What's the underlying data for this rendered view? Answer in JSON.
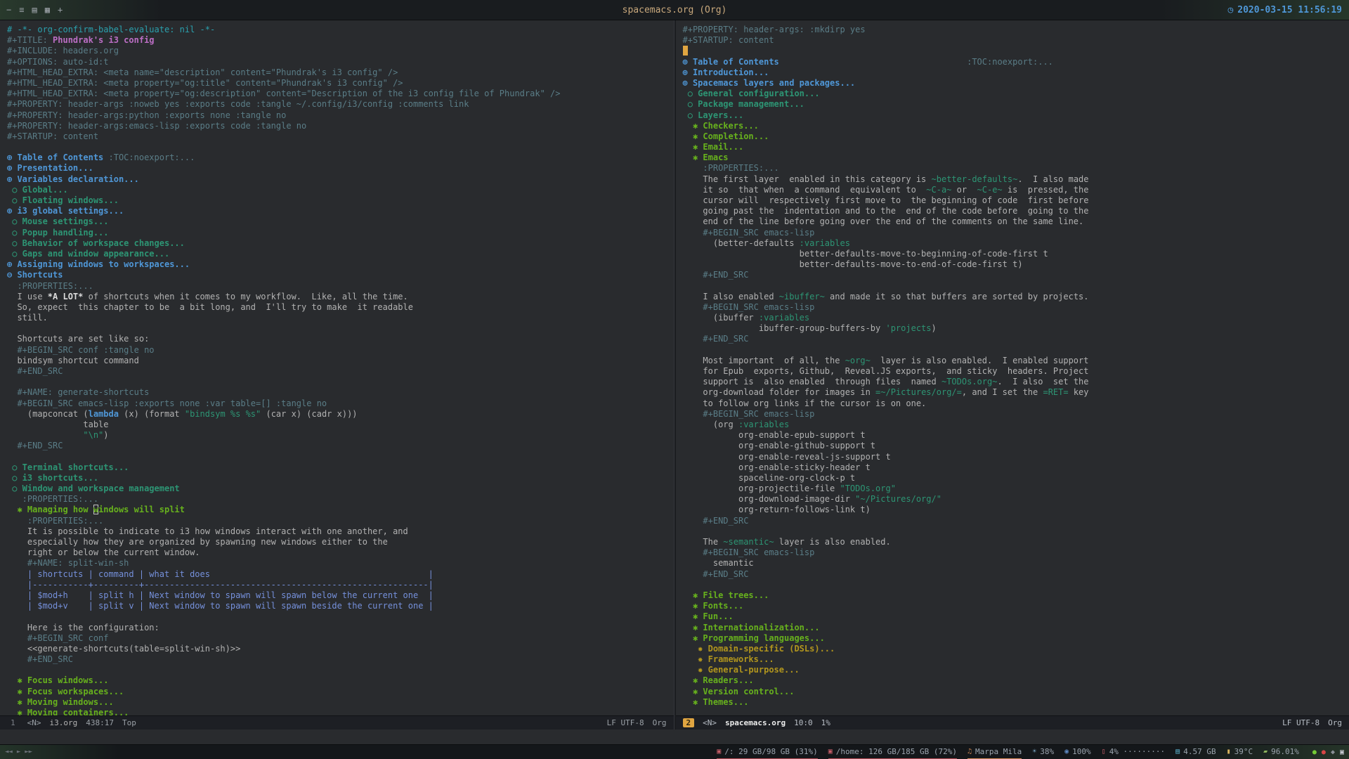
{
  "topbar": {
    "window_buttons": [
      "−",
      "≡",
      "▤",
      "▦",
      "+"
    ],
    "title": "spacemacs.org (Org)",
    "clock_icon": "◷",
    "datetime": "2020-03-15 11:56:19"
  },
  "colors": {
    "background": "#292b2e",
    "foreground": "#b2b2b2",
    "comment": "#2aa1ae",
    "document_title": "#bc6ec5",
    "heading1": "#4f97d7",
    "heading2": "#2d9574",
    "heading3": "#67b11d",
    "heading4": "#b1951d",
    "table": "#7590db",
    "inline_code": "#2d9574",
    "cursor": "#e0a541",
    "datetime_accent": "#4f97d7"
  },
  "left_pane": {
    "lines": [
      [
        [
          "cm",
          "# -*- org-confirm-babel-evaluate: nil -*-"
        ]
      ],
      [
        [
          "mt",
          "#+TITLE: "
        ],
        [
          "ttl",
          "Phundrak's i3 config"
        ]
      ],
      [
        [
          "mt",
          "#+INCLUDE: headers.org"
        ]
      ],
      [
        [
          "mt",
          "#+OPTIONS: auto-id:t"
        ]
      ],
      [
        [
          "mt",
          "#+HTML_HEAD_EXTRA: <meta name=\"description\" content=\"Phundrak's i3 config\" />"
        ]
      ],
      [
        [
          "mt",
          "#+HTML_HEAD_EXTRA: <meta property=\"og:title\" content=\"Phundrak's i3 config\" />"
        ]
      ],
      [
        [
          "mt",
          "#+HTML_HEAD_EXTRA: <meta property=\"og:description\" content=\"Description of the i3 config file of Phundrak\" />"
        ]
      ],
      [
        [
          "mt",
          "#+PROPERTY: header-args :noweb yes :exports code :tangle ~/.config/i3/config :comments link"
        ]
      ],
      [
        [
          "mt",
          "#+PROPERTY: header-args:python :exports none :tangle no"
        ]
      ],
      [
        [
          "mt",
          "#+PROPERTY: header-args:emacs-lisp :exports code :tangle no"
        ]
      ],
      [
        [
          "mt",
          "#+STARTUP: content"
        ]
      ],
      [],
      [
        [
          "h1",
          "⊕ Table of Contents "
        ],
        [
          "mt",
          ":TOC:noexport:..."
        ]
      ],
      [
        [
          "h1",
          "⊕ Presentation..."
        ]
      ],
      [
        [
          "h1",
          "⊕ Variables declaration..."
        ]
      ],
      [
        [
          "h2",
          " ○ Global..."
        ]
      ],
      [
        [
          "h2",
          " ○ Floating windows..."
        ]
      ],
      [
        [
          "h1",
          "⊕ i3 global settings..."
        ]
      ],
      [
        [
          "h2",
          " ○ Mouse settings..."
        ]
      ],
      [
        [
          "h2",
          " ○ Popup handling..."
        ]
      ],
      [
        [
          "h2",
          " ○ Behavior of workspace changes..."
        ]
      ],
      [
        [
          "h2",
          " ○ Gaps and window appearance..."
        ]
      ],
      [
        [
          "h1",
          "⊕ Assigning windows to workspaces..."
        ]
      ],
      [
        [
          "h1",
          "⊖ Shortcuts"
        ]
      ],
      [
        [
          "mt",
          "  :PROPERTIES:..."
        ]
      ],
      [
        [
          "fg",
          "  I use "
        ],
        [
          "bd",
          "*A LOT*"
        ],
        [
          "fg",
          " of shortcuts when it comes to my workflow.  Like, all the time."
        ]
      ],
      [
        [
          "fg",
          "  So, expect  this chapter to be  a bit long, and  I'll try to make  it readable"
        ]
      ],
      [
        [
          "fg",
          "  still."
        ]
      ],
      [],
      [
        [
          "fg",
          "  Shortcuts are set like so:"
        ]
      ],
      [
        [
          "mt",
          "  #+BEGIN_SRC conf :tangle no"
        ]
      ],
      [
        [
          "fg",
          "  bindsym shortcut command"
        ]
      ],
      [
        [
          "mt",
          "  #+END_SRC"
        ]
      ],
      [],
      [
        [
          "mt",
          "  #+NAME: generate-shortcuts"
        ]
      ],
      [
        [
          "mt",
          "  #+BEGIN_SRC emacs-lisp :exports none :var table=[] :tangle no"
        ]
      ],
      [
        [
          "fg",
          "    (mapconcat ("
        ],
        [
          "kw",
          "lambda"
        ],
        [
          "fg",
          " (x) (format "
        ],
        [
          "gr",
          "\"bindsym %s %s\""
        ],
        [
          "fg",
          " (car x) (cadr x)))"
        ]
      ],
      [
        [
          "fg",
          "               table"
        ]
      ],
      [
        [
          "fg",
          "               "
        ],
        [
          "gr",
          "\"\\n\""
        ],
        [
          "fg",
          ")"
        ]
      ],
      [
        [
          "mt",
          "  #+END_SRC"
        ]
      ],
      [],
      [
        [
          "h2",
          " ○ Terminal shortcuts..."
        ]
      ],
      [
        [
          "h2",
          " ○ i3 shortcuts..."
        ]
      ],
      [
        [
          "h2",
          " ○ Window and workspace management"
        ]
      ],
      [
        [
          "mt",
          "   :PROPERTIES:..."
        ]
      ],
      [
        [
          "h3",
          "  ✱ Managing how "
        ],
        [
          "curh",
          "w"
        ],
        [
          "h3",
          "indows will split"
        ]
      ],
      [
        [
          "mt",
          "    :PROPERTIES:..."
        ]
      ],
      [
        [
          "fg",
          "    It is possible to indicate to i3 how windows interact with one another, and"
        ]
      ],
      [
        [
          "fg",
          "    especially how they are organized by spawning new windows either to the"
        ]
      ],
      [
        [
          "fg",
          "    right or below the current window."
        ]
      ],
      [
        [
          "mt",
          "    #+NAME: split-win-sh"
        ]
      ],
      [
        [
          "tb",
          "    | shortcuts | command | what it does                                           |"
        ]
      ],
      [
        [
          "tb",
          "    |-----------+---------+--------------------------------------------------------|"
        ]
      ],
      [
        [
          "tb",
          "    | $mod+h    | split h | Next window to spawn will spawn below the current one  |"
        ]
      ],
      [
        [
          "tb",
          "    | $mod+v    | split v | Next window to spawn will spawn beside the current one |"
        ]
      ],
      [],
      [
        [
          "fg",
          "    Here is the configuration:"
        ]
      ],
      [
        [
          "mt",
          "    #+BEGIN_SRC conf"
        ]
      ],
      [
        [
          "fg",
          "    <<generate-shortcuts(table=split-win-sh)>>"
        ]
      ],
      [
        [
          "mt",
          "    #+END_SRC"
        ]
      ],
      [],
      [
        [
          "h3",
          "  ✱ Focus windows..."
        ]
      ],
      [
        [
          "h3",
          "  ✱ Focus workspaces..."
        ]
      ],
      [
        [
          "h3",
          "  ✱ Moving windows..."
        ]
      ],
      [
        [
          "h3",
          "  ✱ Moving containers..."
        ]
      ]
    ]
  },
  "right_pane": {
    "lines": [
      [
        [
          "mt",
          "#+PROPERTY: header-args: :mkdirp yes"
        ]
      ],
      [
        [
          "mt",
          "#+STARTUP: content"
        ]
      ],
      [
        [
          "curb",
          " "
        ]
      ],
      [
        [
          "h1",
          "⊕ Table of Contents"
        ],
        [
          "mt",
          "                                     :TOC:noexport:..."
        ]
      ],
      [
        [
          "h1",
          "⊕ Introduction..."
        ]
      ],
      [
        [
          "h1",
          "⊕ Spacemacs layers and packages..."
        ]
      ],
      [
        [
          "h2",
          " ○ General configuration..."
        ]
      ],
      [
        [
          "h2",
          " ○ Package management..."
        ]
      ],
      [
        [
          "h2",
          " ○ Layers..."
        ]
      ],
      [
        [
          "h3",
          "  ✱ Checkers..."
        ]
      ],
      [
        [
          "h3",
          "  ✱ Completion..."
        ]
      ],
      [
        [
          "h3",
          "  ✱ Email..."
        ]
      ],
      [
        [
          "h3",
          "  ✱ Emacs"
        ]
      ],
      [
        [
          "mt",
          "    :PROPERTIES:..."
        ]
      ],
      [
        [
          "fg",
          "    The first layer  enabled in this category is "
        ],
        [
          "gr",
          "~better-defaults~"
        ],
        [
          "fg",
          ".  I also made"
        ]
      ],
      [
        [
          "fg",
          "    it so  that when  a command  equivalent to  "
        ],
        [
          "gr",
          "~C-a~"
        ],
        [
          "fg",
          " or  "
        ],
        [
          "gr",
          "~C-e~"
        ],
        [
          "fg",
          " is  pressed, the"
        ]
      ],
      [
        [
          "fg",
          "    cursor will  respectively first move to  the beginning of code  first before"
        ]
      ],
      [
        [
          "fg",
          "    going past the  indentation and to the  end of the code before  going to the"
        ]
      ],
      [
        [
          "fg",
          "    end of the line before going over the end of the comments on the same line."
        ]
      ],
      [
        [
          "mt",
          "    #+BEGIN_SRC emacs-lisp"
        ]
      ],
      [
        [
          "fg",
          "      (better-defaults "
        ],
        [
          "gr",
          ":variables"
        ]
      ],
      [
        [
          "fg",
          "                       better-defaults-move-to-beginning-of-code-first t"
        ]
      ],
      [
        [
          "fg",
          "                       better-defaults-move-to-end-of-code-first t)"
        ]
      ],
      [
        [
          "mt",
          "    #+END_SRC"
        ]
      ],
      [],
      [
        [
          "fg",
          "    I also enabled "
        ],
        [
          "gr",
          "~ibuffer~"
        ],
        [
          "fg",
          " and made it so that buffers are sorted by projects."
        ]
      ],
      [
        [
          "mt",
          "    #+BEGIN_SRC emacs-lisp"
        ]
      ],
      [
        [
          "fg",
          "      (ibuffer "
        ],
        [
          "gr",
          ":variables"
        ]
      ],
      [
        [
          "fg",
          "               ibuffer-group-buffers-by "
        ],
        [
          "gr",
          "'projects"
        ],
        [
          "fg",
          ")"
        ]
      ],
      [
        [
          "mt",
          "    #+END_SRC"
        ]
      ],
      [],
      [
        [
          "fg",
          "    Most important  of all, the "
        ],
        [
          "gr",
          "~org~"
        ],
        [
          "fg",
          "  layer is also enabled.  I enabled support"
        ]
      ],
      [
        [
          "fg",
          "    for Epub  exports, Github,  Reveal.JS exports,  and sticky  headers. Project"
        ]
      ],
      [
        [
          "fg",
          "    support is  also enabled  through files  named "
        ],
        [
          "gr",
          "~TODOs.org~"
        ],
        [
          "fg",
          ".  I also  set the"
        ]
      ],
      [
        [
          "fg",
          "    org-download folder for images in "
        ],
        [
          "gr",
          "=~/Pictures/org/="
        ],
        [
          "fg",
          ", and I set the "
        ],
        [
          "gr",
          "=RET="
        ],
        [
          "fg",
          " key"
        ]
      ],
      [
        [
          "fg",
          "    to follow org links if the cursor is on one."
        ]
      ],
      [
        [
          "mt",
          "    #+BEGIN_SRC emacs-lisp"
        ]
      ],
      [
        [
          "fg",
          "      (org "
        ],
        [
          "gr",
          ":variables"
        ]
      ],
      [
        [
          "fg",
          "           org-enable-epub-support t"
        ]
      ],
      [
        [
          "fg",
          "           org-enable-github-support t"
        ]
      ],
      [
        [
          "fg",
          "           org-enable-reveal-js-support t"
        ]
      ],
      [
        [
          "fg",
          "           org-enable-sticky-header t"
        ]
      ],
      [
        [
          "fg",
          "           spaceline-org-clock-p t"
        ]
      ],
      [
        [
          "fg",
          "           org-projectile-file "
        ],
        [
          "gr",
          "\"TODOs.org\""
        ]
      ],
      [
        [
          "fg",
          "           org-download-image-dir "
        ],
        [
          "gr",
          "\"~/Pictures/org/\""
        ]
      ],
      [
        [
          "fg",
          "           org-return-follows-link t)"
        ]
      ],
      [
        [
          "mt",
          "    #+END_SRC"
        ]
      ],
      [],
      [
        [
          "fg",
          "    The "
        ],
        [
          "gr",
          "~semantic~"
        ],
        [
          "fg",
          " layer is also enabled."
        ]
      ],
      [
        [
          "mt",
          "    #+BEGIN_SRC emacs-lisp"
        ]
      ],
      [
        [
          "fg",
          "      semantic"
        ]
      ],
      [
        [
          "mt",
          "    #+END_SRC"
        ]
      ],
      [],
      [
        [
          "h3",
          "  ✱ File trees..."
        ]
      ],
      [
        [
          "h3",
          "  ✱ Fonts..."
        ]
      ],
      [
        [
          "h3",
          "  ✱ Fun..."
        ]
      ],
      [
        [
          "h3",
          "  ✱ Internationalization..."
        ]
      ],
      [
        [
          "h3",
          "  ✱ Programming languages..."
        ]
      ],
      [
        [
          "h4",
          "   ✸ Domain-specific (DSLs)..."
        ]
      ],
      [
        [
          "h4",
          "   ✸ Frameworks..."
        ]
      ],
      [
        [
          "h4",
          "   ✸ General-purpose..."
        ]
      ],
      [
        [
          "h3",
          "  ✱ Readers..."
        ]
      ],
      [
        [
          "h3",
          "  ✱ Version control..."
        ]
      ],
      [
        [
          "h3",
          "  ✱ Themes..."
        ]
      ]
    ]
  },
  "modeline_left": {
    "win": "1",
    "state": "<N>",
    "file": "i3.org",
    "pos": "438:17",
    "scroll": "Top",
    "enc": "LF UTF-8",
    "mode": "Org"
  },
  "modeline_right": {
    "win": "2",
    "state": "<N>",
    "file": "spacemacs.org",
    "pos": "10:0",
    "scroll": "1%",
    "enc": "LF UTF-8",
    "mode": "Org"
  },
  "bottombar": {
    "media_controls": [
      "◄◄",
      "►",
      "►►"
    ],
    "modules": [
      {
        "name": "disk-root",
        "icon": "▣",
        "icon_color": "#c75e68",
        "underline": "#b04a52",
        "text": "/: 29 GB/98 GB (31%)"
      },
      {
        "name": "disk-home",
        "icon": "▣",
        "icon_color": "#c75e68",
        "underline": "#b04a52",
        "text": "/home: 126 GB/185 GB (72%)"
      },
      {
        "name": "now-playing",
        "icon": "♫",
        "icon_color": "#d08755",
        "underline": "#d08755",
        "text": "Marpa Mila"
      },
      {
        "name": "brightness",
        "icon": "☀",
        "icon_color": "#7aa6c2",
        "underline": "",
        "text": "38%"
      },
      {
        "name": "volume",
        "icon": "◉",
        "icon_color": "#5d87bf",
        "underline": "",
        "text": "100%"
      },
      {
        "name": "cpu-load",
        "icon": "▯",
        "icon_color": "#c75e68",
        "underline": "",
        "text": "4% ·········"
      },
      {
        "name": "memory",
        "icon": "▤",
        "icon_color": "#56a8c2",
        "underline": "",
        "text": "4.57 GB"
      },
      {
        "name": "temperature",
        "icon": "▮",
        "icon_color": "#d9b45f",
        "underline": "",
        "text": "39°C"
      },
      {
        "name": "battery",
        "icon": "▰",
        "icon_color": "#8fb55e",
        "underline": "",
        "text": "96.01%"
      }
    ],
    "tray": [
      {
        "name": "tray-dot-green",
        "glyph": "●",
        "color": "#73c936"
      },
      {
        "name": "tray-dot-red",
        "glyph": "●",
        "color": "#d64545"
      },
      {
        "name": "tray-icon-gray",
        "glyph": "◆",
        "color": "#8a9097"
      },
      {
        "name": "tray-icon-light",
        "glyph": "▣",
        "color": "#c7ccd3"
      }
    ]
  }
}
